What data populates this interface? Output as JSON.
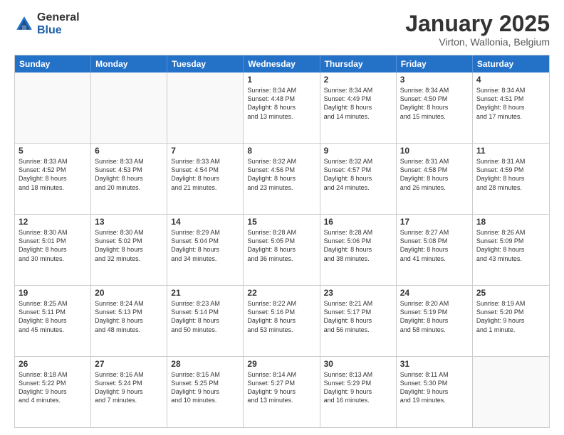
{
  "header": {
    "logo_general": "General",
    "logo_blue": "Blue",
    "month": "January 2025",
    "location": "Virton, Wallonia, Belgium"
  },
  "days_of_week": [
    "Sunday",
    "Monday",
    "Tuesday",
    "Wednesday",
    "Thursday",
    "Friday",
    "Saturday"
  ],
  "weeks": [
    [
      {
        "day": "",
        "text": ""
      },
      {
        "day": "",
        "text": ""
      },
      {
        "day": "",
        "text": ""
      },
      {
        "day": "1",
        "text": "Sunrise: 8:34 AM\nSunset: 4:48 PM\nDaylight: 8 hours\nand 13 minutes."
      },
      {
        "day": "2",
        "text": "Sunrise: 8:34 AM\nSunset: 4:49 PM\nDaylight: 8 hours\nand 14 minutes."
      },
      {
        "day": "3",
        "text": "Sunrise: 8:34 AM\nSunset: 4:50 PM\nDaylight: 8 hours\nand 15 minutes."
      },
      {
        "day": "4",
        "text": "Sunrise: 8:34 AM\nSunset: 4:51 PM\nDaylight: 8 hours\nand 17 minutes."
      }
    ],
    [
      {
        "day": "5",
        "text": "Sunrise: 8:33 AM\nSunset: 4:52 PM\nDaylight: 8 hours\nand 18 minutes."
      },
      {
        "day": "6",
        "text": "Sunrise: 8:33 AM\nSunset: 4:53 PM\nDaylight: 8 hours\nand 20 minutes."
      },
      {
        "day": "7",
        "text": "Sunrise: 8:33 AM\nSunset: 4:54 PM\nDaylight: 8 hours\nand 21 minutes."
      },
      {
        "day": "8",
        "text": "Sunrise: 8:32 AM\nSunset: 4:56 PM\nDaylight: 8 hours\nand 23 minutes."
      },
      {
        "day": "9",
        "text": "Sunrise: 8:32 AM\nSunset: 4:57 PM\nDaylight: 8 hours\nand 24 minutes."
      },
      {
        "day": "10",
        "text": "Sunrise: 8:31 AM\nSunset: 4:58 PM\nDaylight: 8 hours\nand 26 minutes."
      },
      {
        "day": "11",
        "text": "Sunrise: 8:31 AM\nSunset: 4:59 PM\nDaylight: 8 hours\nand 28 minutes."
      }
    ],
    [
      {
        "day": "12",
        "text": "Sunrise: 8:30 AM\nSunset: 5:01 PM\nDaylight: 8 hours\nand 30 minutes."
      },
      {
        "day": "13",
        "text": "Sunrise: 8:30 AM\nSunset: 5:02 PM\nDaylight: 8 hours\nand 32 minutes."
      },
      {
        "day": "14",
        "text": "Sunrise: 8:29 AM\nSunset: 5:04 PM\nDaylight: 8 hours\nand 34 minutes."
      },
      {
        "day": "15",
        "text": "Sunrise: 8:28 AM\nSunset: 5:05 PM\nDaylight: 8 hours\nand 36 minutes."
      },
      {
        "day": "16",
        "text": "Sunrise: 8:28 AM\nSunset: 5:06 PM\nDaylight: 8 hours\nand 38 minutes."
      },
      {
        "day": "17",
        "text": "Sunrise: 8:27 AM\nSunset: 5:08 PM\nDaylight: 8 hours\nand 41 minutes."
      },
      {
        "day": "18",
        "text": "Sunrise: 8:26 AM\nSunset: 5:09 PM\nDaylight: 8 hours\nand 43 minutes."
      }
    ],
    [
      {
        "day": "19",
        "text": "Sunrise: 8:25 AM\nSunset: 5:11 PM\nDaylight: 8 hours\nand 45 minutes."
      },
      {
        "day": "20",
        "text": "Sunrise: 8:24 AM\nSunset: 5:13 PM\nDaylight: 8 hours\nand 48 minutes."
      },
      {
        "day": "21",
        "text": "Sunrise: 8:23 AM\nSunset: 5:14 PM\nDaylight: 8 hours\nand 50 minutes."
      },
      {
        "day": "22",
        "text": "Sunrise: 8:22 AM\nSunset: 5:16 PM\nDaylight: 8 hours\nand 53 minutes."
      },
      {
        "day": "23",
        "text": "Sunrise: 8:21 AM\nSunset: 5:17 PM\nDaylight: 8 hours\nand 56 minutes."
      },
      {
        "day": "24",
        "text": "Sunrise: 8:20 AM\nSunset: 5:19 PM\nDaylight: 8 hours\nand 58 minutes."
      },
      {
        "day": "25",
        "text": "Sunrise: 8:19 AM\nSunset: 5:20 PM\nDaylight: 9 hours\nand 1 minute."
      }
    ],
    [
      {
        "day": "26",
        "text": "Sunrise: 8:18 AM\nSunset: 5:22 PM\nDaylight: 9 hours\nand 4 minutes."
      },
      {
        "day": "27",
        "text": "Sunrise: 8:16 AM\nSunset: 5:24 PM\nDaylight: 9 hours\nand 7 minutes."
      },
      {
        "day": "28",
        "text": "Sunrise: 8:15 AM\nSunset: 5:25 PM\nDaylight: 9 hours\nand 10 minutes."
      },
      {
        "day": "29",
        "text": "Sunrise: 8:14 AM\nSunset: 5:27 PM\nDaylight: 9 hours\nand 13 minutes."
      },
      {
        "day": "30",
        "text": "Sunrise: 8:13 AM\nSunset: 5:29 PM\nDaylight: 9 hours\nand 16 minutes."
      },
      {
        "day": "31",
        "text": "Sunrise: 8:11 AM\nSunset: 5:30 PM\nDaylight: 9 hours\nand 19 minutes."
      },
      {
        "day": "",
        "text": ""
      }
    ]
  ]
}
